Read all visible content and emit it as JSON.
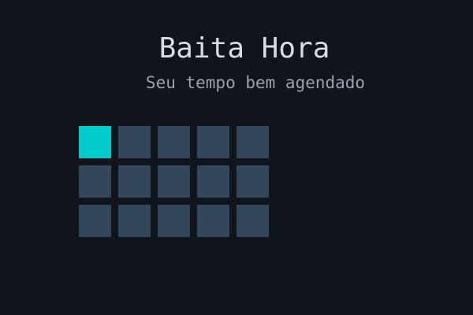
{
  "header": {
    "title": "Baita Hora",
    "subtitle": "Seu tempo bem agendado"
  },
  "grid": {
    "rows": 3,
    "columns": 5,
    "active_index": 0
  },
  "colors": {
    "background": "#10141b",
    "title": "#d9dde3",
    "subtitle": "#9aa3ad",
    "cell": "#33475b",
    "cell_active": "#00cccc"
  }
}
